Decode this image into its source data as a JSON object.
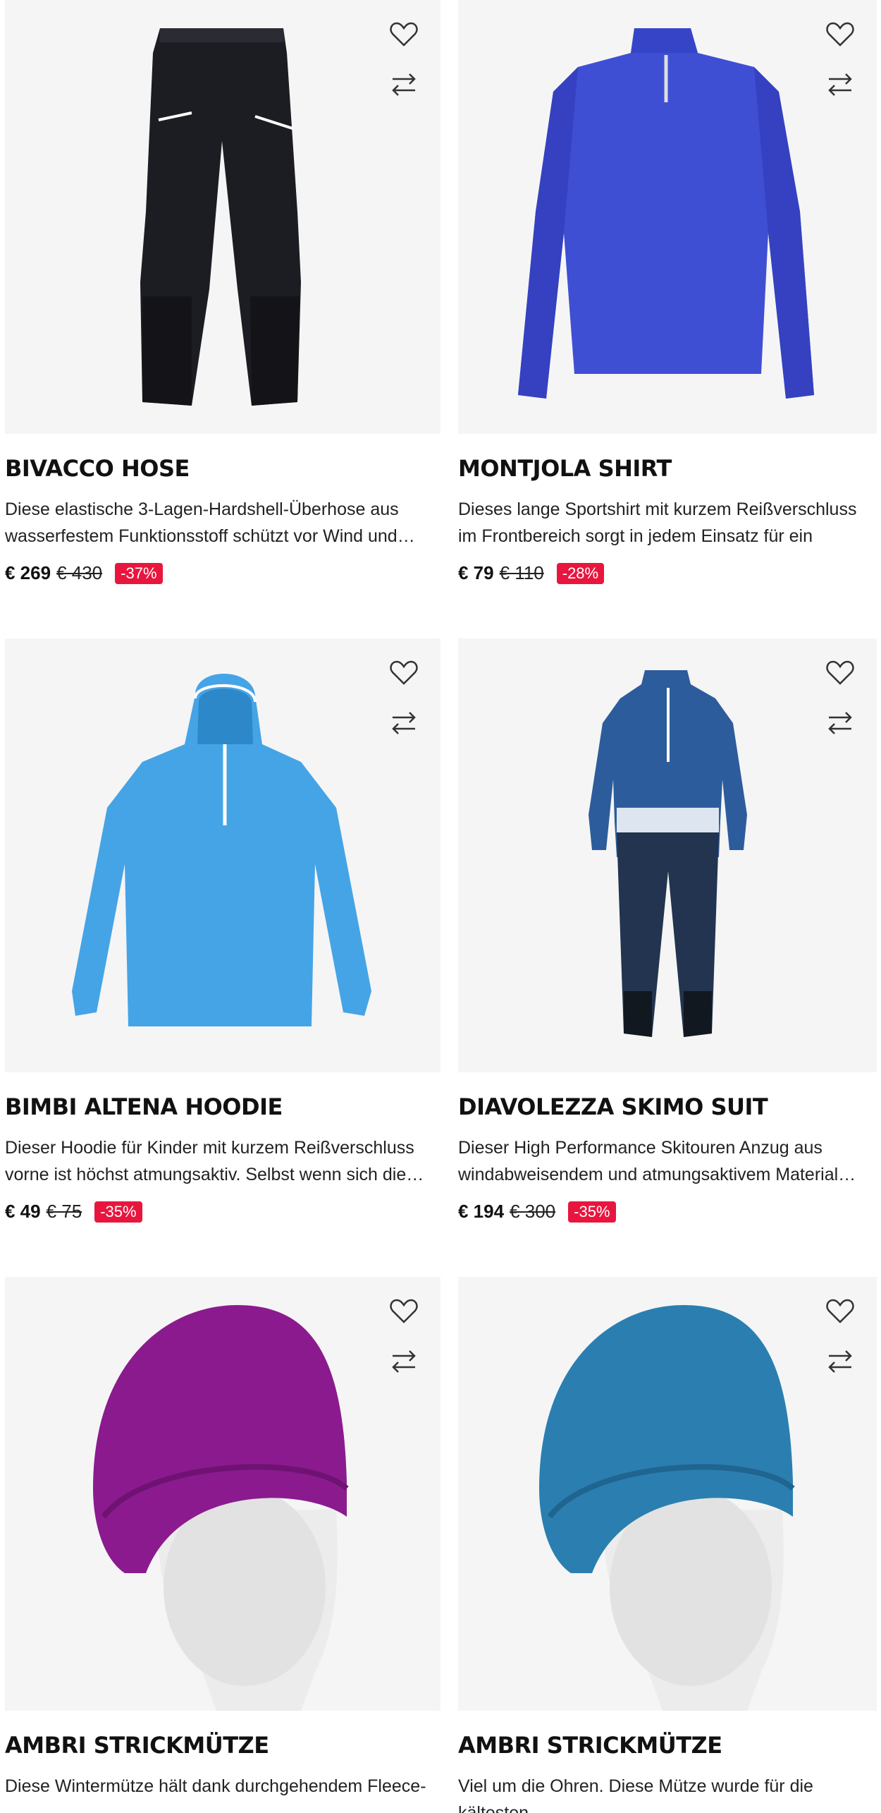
{
  "products": [
    {
      "title": "BIVACCO HOSE",
      "description": "Diese elastische 3-Lagen-Hardshell-Überhose aus wasserfestem Funktionsstoff schützt vor Wind und…",
      "price": "€ 269",
      "old_price": "€ 430",
      "discount": "-37%",
      "image_icon": "black-pants",
      "color": "#1c1d23"
    },
    {
      "title": "MONTJOLA SHIRT",
      "description": "Dieses lange Sportshirt mit kurzem Reißverschluss im Frontbereich sorgt in jedem Einsatz für ein perfektes…",
      "price": "€ 79",
      "old_price": "€ 110",
      "discount": "-28%",
      "image_icon": "blue-long-sleeve-shirt",
      "color": "#3f4fd4"
    },
    {
      "title": "BIMBI ALTENA HOODIE",
      "description": "Dieser Hoodie für Kinder mit kurzem Reißverschluss vorne ist höchst atmungsaktiv. Selbst wenn sich die…",
      "price": "€ 49",
      "old_price": "€ 75",
      "discount": "-35%",
      "image_icon": "light-blue-hoodie",
      "color": "#45a4e6"
    },
    {
      "title": "DIAVOLEZZA SKIMO SUIT",
      "description": "Dieser High Performance Skitouren Anzug aus windabweisendem und atmungsaktivem Material…",
      "price": "€ 194",
      "old_price": "€ 300",
      "discount": "-35%",
      "image_icon": "skimo-race-suit",
      "color": "#2d5c9c"
    },
    {
      "title": "AMBRI STRICKMÜTZE",
      "description": "Diese Wintermütze hält dank durchgehendem Fleece-",
      "price": "",
      "old_price": "",
      "discount": "",
      "image_icon": "purple-beanie",
      "color": "#8b1a8f"
    },
    {
      "title": "AMBRI STRICKMÜTZE",
      "description": "Viel um die Ohren. Diese Mütze wurde für die kältesten",
      "price": "",
      "old_price": "",
      "discount": "",
      "image_icon": "blue-beanie",
      "color": "#2a7fb0"
    }
  ],
  "colors": {
    "sale_badge": "#e8163e",
    "image_background": "#f5f5f5"
  }
}
